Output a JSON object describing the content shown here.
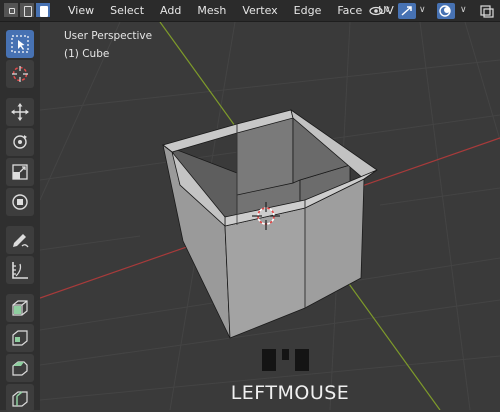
{
  "header": {
    "menu": [
      "View",
      "Select",
      "Add",
      "Mesh",
      "Vertex",
      "Edge",
      "Face",
      "UV"
    ]
  },
  "viewport": {
    "perspective_label": "User Perspective",
    "object_label": "(1) Cube",
    "key_hint": "LEFTMOUSE"
  },
  "toolbar": {
    "tools": [
      "select-box",
      "cursor",
      "move",
      "rotate",
      "scale",
      "transform",
      "annotate",
      "measure",
      "extrude-region",
      "inset-faces",
      "bevel",
      "loop-cut"
    ],
    "active_tool": "select-box"
  },
  "colors": {
    "accent": "#4772b3",
    "header_bg": "#2b2b2b",
    "viewport_bg": "#3a3a3a",
    "x_axis": "#a83a3a",
    "y_axis": "#7e9b2a"
  }
}
